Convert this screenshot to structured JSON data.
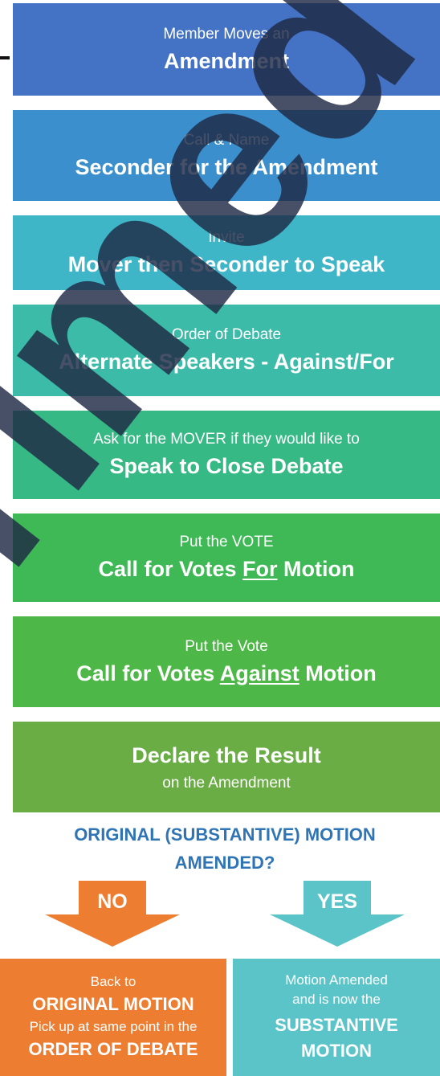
{
  "steps": [
    {
      "sub": "Member Moves an",
      "main": "Amendment",
      "color": "#4472c4"
    },
    {
      "sub": "Call & Name",
      "main": "Seconder for the Amendment",
      "color": "#3a8fcc"
    },
    {
      "sub": "Invite",
      "main": "Mover then Seconder to Speak",
      "color": "#3fb5c8"
    },
    {
      "sub": "Order of Debate",
      "main": "Alternate Speakers - Against/For",
      "color": "#3cbca8"
    },
    {
      "sub": "Ask for the MOVER if they would like to",
      "main": "Speak to Close Debate",
      "color": "#37b985"
    },
    {
      "sub": "Put the VOTE",
      "main_pre": "Call for Votes ",
      "main_u": "For",
      "main_post": " Motion",
      "color": "#3eb955"
    },
    {
      "sub": "Put the Vote",
      "main_pre": "Call for Votes ",
      "main_u": "Against",
      "main_post": " Motion",
      "color": "#4db847"
    },
    {
      "main": "Declare the Result",
      "sub": "on the Amendment",
      "color": "#6aad45"
    }
  ],
  "question": {
    "line1": "ORIGINAL (SUBSTANTIVE) MOTION",
    "line2": "AMENDED?",
    "color": "#2f75b6"
  },
  "branches": {
    "no": {
      "label": "NO",
      "color": "#ed7d31",
      "line1": "Back to",
      "line2": "ORIGINAL MOTION",
      "line3": "Pick up at same point in the",
      "line4": "ORDER OF DEBATE"
    },
    "yes": {
      "label": "YES",
      "color": "#5bc4c8",
      "line1": "Motion Amended",
      "line2": "and is now the",
      "line3": "SUBSTANTIVE",
      "line4": "MOTION"
    }
  },
  "watermark": {
    "text": "rimed",
    "color": "#1e2a44"
  }
}
